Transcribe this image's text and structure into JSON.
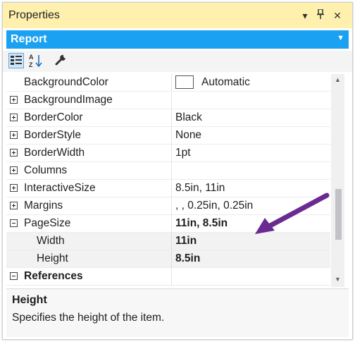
{
  "panel": {
    "title": "Properties",
    "object_name": "Report",
    "title_controls": {
      "dropdown_glyph": "▾",
      "pin_glyph": "⊥",
      "close_glyph": "✕"
    }
  },
  "toolbar": {
    "items": [
      {
        "name": "categorized-icon",
        "active": true
      },
      {
        "name": "alphabetical-icon",
        "active": false
      },
      {
        "name": "property-pages-icon",
        "active": false
      }
    ]
  },
  "properties": {
    "background_color": {
      "name": "BackgroundColor",
      "value": "Automatic"
    },
    "background_image": {
      "name": "BackgroundImage",
      "value": ""
    },
    "border_color": {
      "name": "BorderColor",
      "value": "Black"
    },
    "border_style": {
      "name": "BorderStyle",
      "value": "None"
    },
    "border_width": {
      "name": "BorderWidth",
      "value": "1pt"
    },
    "columns": {
      "name": "Columns",
      "value": ""
    },
    "interactive_size": {
      "name": "InteractiveSize",
      "value": "8.5in, 11in"
    },
    "margins": {
      "name": "Margins",
      "value": ", , 0.25in, 0.25in"
    },
    "page_size": {
      "name": "PageSize",
      "value": "11in, 8.5in"
    },
    "width": {
      "name": "Width",
      "value": "11in"
    },
    "height": {
      "name": "Height",
      "value": "8.5in"
    },
    "references": {
      "name": "References",
      "value": ""
    }
  },
  "description": {
    "title": "Height",
    "text": "Specifies the height of the item."
  },
  "annotation": {
    "arrow_color": "#6a2a92"
  },
  "colors": {
    "titlebar": "#fff1ad",
    "object_bar": "#1ba1f1"
  }
}
